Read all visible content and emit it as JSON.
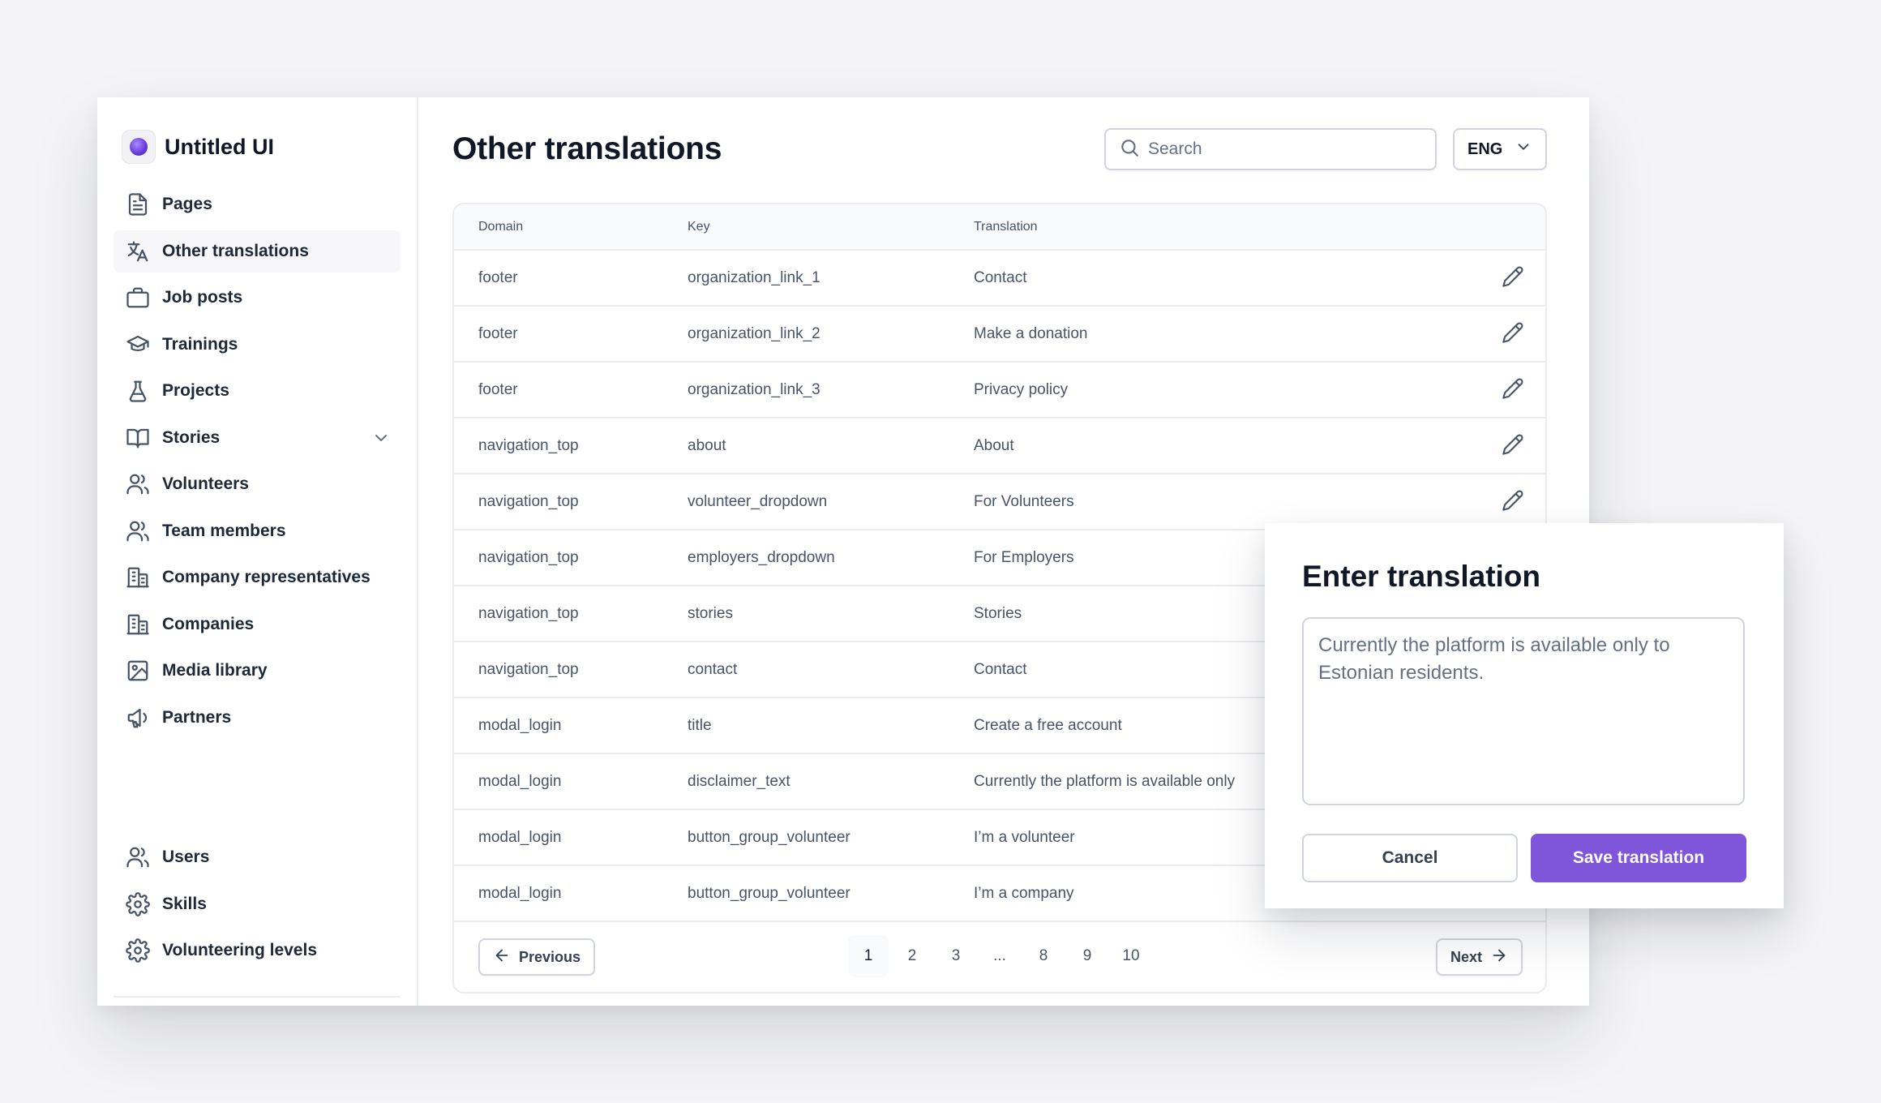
{
  "brand": {
    "name": "Untitled UI"
  },
  "sidebar": {
    "items": [
      {
        "label": "Pages",
        "icon": "file-icon"
      },
      {
        "label": "Other translations",
        "icon": "translate-icon",
        "active": true
      },
      {
        "label": "Job posts",
        "icon": "briefcase-icon"
      },
      {
        "label": "Trainings",
        "icon": "graduation-cap-icon"
      },
      {
        "label": "Projects",
        "icon": "flask-icon"
      },
      {
        "label": "Stories",
        "icon": "book-open-icon",
        "expandable": true
      },
      {
        "label": "Volunteers",
        "icon": "users-icon"
      },
      {
        "label": "Team members",
        "icon": "users-icon"
      },
      {
        "label": "Company representatives",
        "icon": "building-icon"
      },
      {
        "label": "Companies",
        "icon": "building-icon"
      },
      {
        "label": "Media library",
        "icon": "image-icon"
      },
      {
        "label": "Partners",
        "icon": "megaphone-icon"
      }
    ],
    "bottom_items": [
      {
        "label": "Users",
        "icon": "users-icon"
      },
      {
        "label": "Skills",
        "icon": "gear-icon"
      },
      {
        "label": "Volunteering levels",
        "icon": "gear-icon"
      }
    ]
  },
  "header": {
    "title": "Other translations",
    "search_placeholder": "Search",
    "language": "ENG"
  },
  "table": {
    "columns": [
      "Domain",
      "Key",
      "Translation"
    ],
    "rows": [
      {
        "domain": "footer",
        "key": "organization_link_1",
        "translation": "Contact"
      },
      {
        "domain": "footer",
        "key": "organization_link_2",
        "translation": "Make a donation"
      },
      {
        "domain": "footer",
        "key": "organization_link_3",
        "translation": "Privacy policy"
      },
      {
        "domain": "navigation_top",
        "key": "about",
        "translation": "About"
      },
      {
        "domain": "navigation_top",
        "key": "volunteer_dropdown",
        "translation": "For Volunteers"
      },
      {
        "domain": "navigation_top",
        "key": "employers_dropdown",
        "translation": "For Employers"
      },
      {
        "domain": "navigation_top",
        "key": "stories",
        "translation": "Stories"
      },
      {
        "domain": "navigation_top",
        "key": "contact",
        "translation": "Contact"
      },
      {
        "domain": "modal_login",
        "key": "title",
        "translation": "Create a free account"
      },
      {
        "domain": "modal_login",
        "key": "disclaimer_text",
        "translation": "Currently the platform is available only"
      },
      {
        "domain": "modal_login",
        "key": "button_group_volunteer",
        "translation": "I’m a volunteer"
      },
      {
        "domain": "modal_login",
        "key": "button_group_volunteer",
        "translation": "I’m a company"
      }
    ]
  },
  "pagination": {
    "previous_label": "Previous",
    "next_label": "Next",
    "pages": [
      "1",
      "2",
      "3",
      "...",
      "8",
      "9",
      "10"
    ],
    "current": "1"
  },
  "modal": {
    "title": "Enter translation",
    "value": "Currently the platform is available only to Estonian residents.",
    "cancel_label": "Cancel",
    "save_label": "Save translation"
  },
  "colors": {
    "accent": "#7f56d9",
    "text_primary": "#101828",
    "text_secondary": "#475467",
    "border": "#eaecf0",
    "background": "#f4f4f6"
  }
}
